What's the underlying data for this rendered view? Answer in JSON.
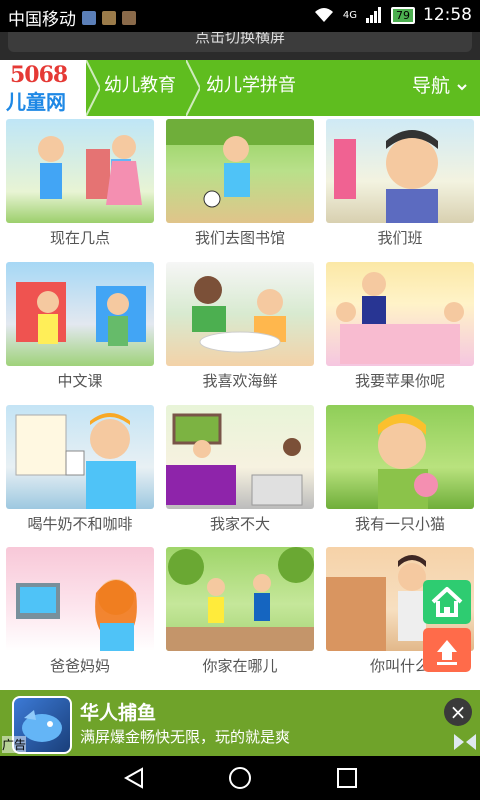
{
  "status_bar": {
    "carrier": "中国移动",
    "network": "4G",
    "battery": "79",
    "time": "12:58"
  },
  "rotate_button": {
    "label": "点击切换横屏"
  },
  "nav": {
    "logo_number": "5068",
    "logo_text": "儿童网",
    "items": [
      {
        "label": "幼儿教育"
      },
      {
        "label": "幼儿学拼音"
      }
    ],
    "dropdown_label": "导航"
  },
  "videos": [
    {
      "title": "现在几点"
    },
    {
      "title": "我们去图书馆"
    },
    {
      "title": "我们班"
    },
    {
      "title": "中文课"
    },
    {
      "title": "我喜欢海鲜"
    },
    {
      "title": "我要苹果你呢"
    },
    {
      "title": "喝牛奶不和咖啡"
    },
    {
      "title": "我家不大"
    },
    {
      "title": "我有一只小猫"
    },
    {
      "title": "爸爸妈妈"
    },
    {
      "title": "你家在哪儿"
    },
    {
      "title": "你叫什么"
    }
  ],
  "ad": {
    "title": "华人捕鱼",
    "description": "满屏爆金畅快无限，玩的就是爽",
    "tag": "广告"
  },
  "colors": {
    "nav_green": "#5fbd1f",
    "home_button": "#2ecc71",
    "top_button": "#ff6b4a"
  }
}
